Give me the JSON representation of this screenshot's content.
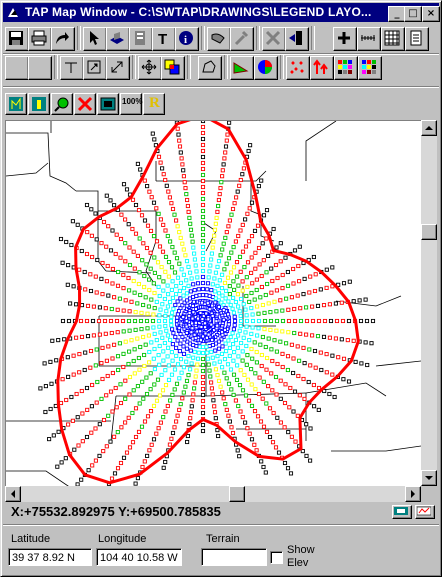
{
  "window": {
    "title": "TAP Map Window - C:\\SWTAP\\DRAWINGS\\LEGEND LAYO...",
    "minimize_label": "_",
    "maximize_label": "□",
    "close_label": "×"
  },
  "toolbar": {
    "row1": [
      "save-icon",
      "print-icon",
      "redo-icon",
      "pointer-icon",
      "layers-icon",
      "document-icon",
      "text-icon",
      "info-icon",
      "measure-icon",
      "tool-icon",
      "delete-icon",
      "exit-icon",
      "add-icon",
      "scale-icon",
      "grid-icon",
      "page-icon"
    ],
    "row2": [
      "blank-icon",
      "blank-icon",
      "line-icon",
      "rotate-icon",
      "resize-icon",
      "pan-icon",
      "overlap-icon",
      "lasso-icon",
      "chart-icon",
      "color-icon",
      "points-icon",
      "arrows-icon",
      "palette-icon",
      "palette2-icon"
    ],
    "row3": [
      "profile-icon",
      "antenna-icon",
      "zoom-icon",
      "cross-icon",
      "display-icon",
      "percent-icon",
      "r-icon"
    ],
    "percent_label": "100%",
    "r_label": "R"
  },
  "status": {
    "coordinates": "X:+75532.892975 Y:+69500.785835"
  },
  "fields": {
    "latitude_label": "Latitude",
    "latitude_value": "39 37 8.92 N",
    "longitude_label": "Longitude",
    "longitude_value": "104 40 10.58 W",
    "terrain_label": "Terrain",
    "terrain_value": "",
    "show_elev_label_1": "Show",
    "show_elev_label_2": "Elev",
    "show_elev_checked": false
  },
  "map": {
    "boundary_color": "#ff0000",
    "radial_colors": [
      "#000000",
      "#ff0000",
      "#ffff00",
      "#00c000",
      "#00ffff",
      "#0000ff"
    ]
  }
}
